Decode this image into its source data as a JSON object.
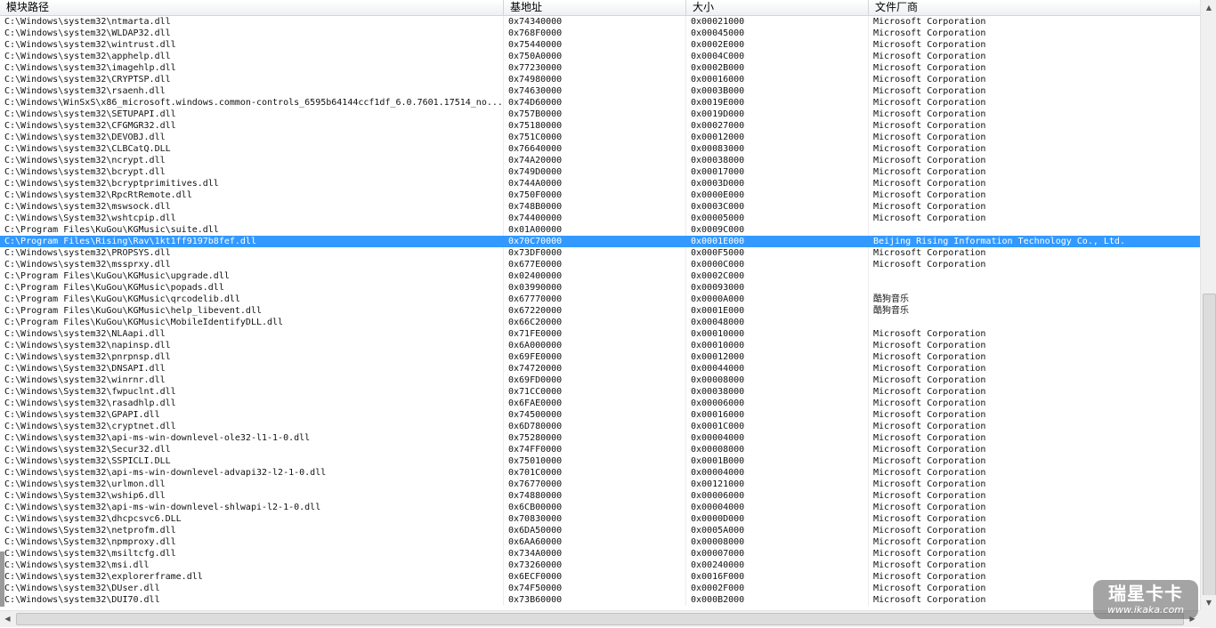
{
  "columns": [
    "模块路径",
    "基地址",
    "大小",
    "文件厂商"
  ],
  "selected_index": 19,
  "colors": {
    "selection": "#3399ff"
  },
  "rows": [
    [
      "C:\\Windows\\system32\\ntmarta.dll",
      "0x74340000",
      "0x00021000",
      "Microsoft Corporation"
    ],
    [
      "C:\\Windows\\system32\\WLDAP32.dll",
      "0x768F0000",
      "0x00045000",
      "Microsoft Corporation"
    ],
    [
      "C:\\Windows\\system32\\wintrust.dll",
      "0x75440000",
      "0x0002E000",
      "Microsoft Corporation"
    ],
    [
      "C:\\Windows\\system32\\apphelp.dll",
      "0x750A0000",
      "0x0004C000",
      "Microsoft Corporation"
    ],
    [
      "C:\\Windows\\system32\\imagehlp.dll",
      "0x77230000",
      "0x0002B000",
      "Microsoft Corporation"
    ],
    [
      "C:\\Windows\\system32\\CRYPTSP.dll",
      "0x74980000",
      "0x00016000",
      "Microsoft Corporation"
    ],
    [
      "C:\\Windows\\system32\\rsaenh.dll",
      "0x74630000",
      "0x0003B000",
      "Microsoft Corporation"
    ],
    [
      "C:\\Windows\\WinSxS\\x86_microsoft.windows.common-controls_6595b64144ccf1df_6.0.7601.17514_no...",
      "0x74D60000",
      "0x0019E000",
      "Microsoft Corporation"
    ],
    [
      "C:\\Windows\\system32\\SETUPAPI.dll",
      "0x757B0000",
      "0x0019D000",
      "Microsoft Corporation"
    ],
    [
      "C:\\Windows\\system32\\CFGMGR32.dll",
      "0x75180000",
      "0x00027000",
      "Microsoft Corporation"
    ],
    [
      "C:\\Windows\\system32\\DEVOBJ.dll",
      "0x751C0000",
      "0x00012000",
      "Microsoft Corporation"
    ],
    [
      "C:\\Windows\\system32\\CLBCatQ.DLL",
      "0x76640000",
      "0x00083000",
      "Microsoft Corporation"
    ],
    [
      "C:\\Windows\\system32\\ncrypt.dll",
      "0x74A20000",
      "0x00038000",
      "Microsoft Corporation"
    ],
    [
      "C:\\Windows\\system32\\bcrypt.dll",
      "0x749D0000",
      "0x00017000",
      "Microsoft Corporation"
    ],
    [
      "C:\\Windows\\system32\\bcryptprimitives.dll",
      "0x744A0000",
      "0x0003D000",
      "Microsoft Corporation"
    ],
    [
      "C:\\Windows\\system32\\RpcRtRemote.dll",
      "0x750F0000",
      "0x0000E000",
      "Microsoft Corporation"
    ],
    [
      "C:\\Windows\\system32\\mswsock.dll",
      "0x748B0000",
      "0x0003C000",
      "Microsoft Corporation"
    ],
    [
      "C:\\Windows\\System32\\wshtcpip.dll",
      "0x74400000",
      "0x00005000",
      "Microsoft Corporation"
    ],
    [
      "C:\\Program Files\\KuGou\\KGMusic\\suite.dll",
      "0x01A00000",
      "0x0009C000",
      ""
    ],
    [
      "C:\\Program Files\\Rising\\Rav\\1kt1ff9197b8fef.dll",
      "0x70C70000",
      "0x0001E000",
      "Beijing Rising Information Technology Co., Ltd."
    ],
    [
      "C:\\Windows\\system32\\PROPSYS.dll",
      "0x73DF0000",
      "0x000F5000",
      "Microsoft Corporation"
    ],
    [
      "C:\\Windows\\system32\\mssprxy.dll",
      "0x677E0000",
      "0x0000C000",
      "Microsoft Corporation"
    ],
    [
      "C:\\Program Files\\KuGou\\KGMusic\\upgrade.dll",
      "0x02400000",
      "0x0002C000",
      ""
    ],
    [
      "C:\\Program Files\\KuGou\\KGMusic\\popads.dll",
      "0x03990000",
      "0x00093000",
      ""
    ],
    [
      "C:\\Program Files\\KuGou\\KGMusic\\qrcodelib.dll",
      "0x67770000",
      "0x0000A000",
      "酷狗音乐"
    ],
    [
      "C:\\Program Files\\KuGou\\KGMusic\\help_libevent.dll",
      "0x67220000",
      "0x0001E000",
      "酷狗音乐"
    ],
    [
      "C:\\Program Files\\KuGou\\KGMusic\\MobileIdentifyDLL.dll",
      "0x66C20000",
      "0x00048000",
      ""
    ],
    [
      "C:\\Windows\\system32\\NLAapi.dll",
      "0x71FE0000",
      "0x00010000",
      "Microsoft Corporation"
    ],
    [
      "C:\\Windows\\system32\\napinsp.dll",
      "0x6A000000",
      "0x00010000",
      "Microsoft Corporation"
    ],
    [
      "C:\\Windows\\system32\\pnrpnsp.dll",
      "0x69FE0000",
      "0x00012000",
      "Microsoft Corporation"
    ],
    [
      "C:\\Windows\\System32\\DNSAPI.dll",
      "0x74720000",
      "0x00044000",
      "Microsoft Corporation"
    ],
    [
      "C:\\Windows\\system32\\winrnr.dll",
      "0x69FD0000",
      "0x00008000",
      "Microsoft Corporation"
    ],
    [
      "C:\\Windows\\System32\\fwpuclnt.dll",
      "0x71CC0000",
      "0x00038000",
      "Microsoft Corporation"
    ],
    [
      "C:\\Windows\\system32\\rasadhlp.dll",
      "0x6FAE0000",
      "0x00006000",
      "Microsoft Corporation"
    ],
    [
      "C:\\Windows\\system32\\GPAPI.dll",
      "0x74500000",
      "0x00016000",
      "Microsoft Corporation"
    ],
    [
      "C:\\Windows\\system32\\cryptnet.dll",
      "0x6D780000",
      "0x0001C000",
      "Microsoft Corporation"
    ],
    [
      "C:\\Windows\\system32\\api-ms-win-downlevel-ole32-l1-1-0.dll",
      "0x75280000",
      "0x00004000",
      "Microsoft Corporation"
    ],
    [
      "C:\\Windows\\system32\\Secur32.dll",
      "0x74FF0000",
      "0x00008000",
      "Microsoft Corporation"
    ],
    [
      "C:\\Windows\\system32\\SSPICLI.DLL",
      "0x75010000",
      "0x0001B000",
      "Microsoft Corporation"
    ],
    [
      "C:\\Windows\\system32\\api-ms-win-downlevel-advapi32-l2-1-0.dll",
      "0x701C0000",
      "0x00004000",
      "Microsoft Corporation"
    ],
    [
      "C:\\Windows\\system32\\urlmon.dll",
      "0x76770000",
      "0x00121000",
      "Microsoft Corporation"
    ],
    [
      "C:\\Windows\\System32\\wship6.dll",
      "0x74880000",
      "0x00006000",
      "Microsoft Corporation"
    ],
    [
      "C:\\Windows\\system32\\api-ms-win-downlevel-shlwapi-l2-1-0.dll",
      "0x6CB00000",
      "0x00004000",
      "Microsoft Corporation"
    ],
    [
      "C:\\Windows\\system32\\dhcpcsvc6.DLL",
      "0x70830000",
      "0x0000D000",
      "Microsoft Corporation"
    ],
    [
      "C:\\Windows\\System32\\netprofm.dll",
      "0x6DA50000",
      "0x0005A000",
      "Microsoft Corporation"
    ],
    [
      "C:\\Windows\\System32\\npmproxy.dll",
      "0x6AA60000",
      "0x00008000",
      "Microsoft Corporation"
    ],
    [
      "C:\\Windows\\system32\\msiltcfg.dll",
      "0x734A0000",
      "0x00007000",
      "Microsoft Corporation"
    ],
    [
      "C:\\Windows\\system32\\msi.dll",
      "0x73260000",
      "0x00240000",
      "Microsoft Corporation"
    ],
    [
      "C:\\Windows\\system32\\explorerframe.dll",
      "0x6ECF0000",
      "0x0016F000",
      "Microsoft Corporation"
    ],
    [
      "C:\\Windows\\system32\\DUser.dll",
      "0x74F50000",
      "0x0002F000",
      "Microsoft Corporation"
    ],
    [
      "C:\\Windows\\system32\\DUI70.dll",
      "0x73B60000",
      "0x000B2000",
      "Microsoft Corporation"
    ]
  ],
  "scrollbar": {
    "up_arrow": "▲",
    "down_arrow": "▼",
    "left_arrow": "◀",
    "right_arrow": "▶"
  },
  "watermark": {
    "text": "瑞星卡卡",
    "url": "www.ikaka.com"
  }
}
